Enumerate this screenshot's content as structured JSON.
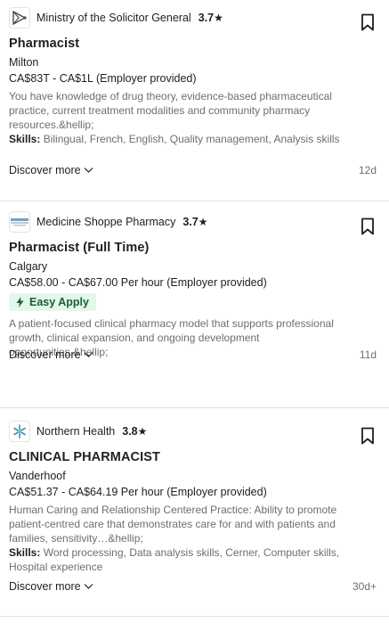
{
  "jobs": [
    {
      "company": "Ministry of the Solicitor General",
      "rating": "3.7",
      "title": "Pharmacist",
      "location": "Milton",
      "salary": "CA$83T - CA$1L (Employer provided)",
      "easy_apply": "",
      "snippet": "You have knowledge of drug theory, evidence-based pharmaceutical practice, current treatment modalities and community pharmacy resources.&hellip;",
      "skills_label": "Skills:",
      "skills": "Bilingual, French, English, Quality management, Analysis skills",
      "discover": "Discover more",
      "age": "12d"
    },
    {
      "company": "Medicine Shoppe Pharmacy",
      "rating": "3.7",
      "title": "Pharmacist (Full Time)",
      "location": "Calgary",
      "salary": "CA$58.00 - CA$67.00 Per hour (Employer provided)",
      "easy_apply": "Easy Apply",
      "snippet": "A patient-focused clinical pharmacy model that supports professional growth, clinical expansion, and ongoing development opportunities.&hellip;",
      "skills_label": "",
      "skills": "",
      "discover": "Discover more",
      "age": "11d"
    },
    {
      "company": "Northern Health",
      "rating": "3.8",
      "title": "CLINICAL PHARMACIST",
      "location": "Vanderhoof",
      "salary": "CA$51.37 - CA$64.19 Per hour (Employer provided)",
      "easy_apply": "",
      "snippet": "Human Caring and Relationship Centered Practice: Ability to promote patient-centred care that demonstrates care for and with patients and families, sensitivity…&hellip;",
      "skills_label": "Skills:",
      "skills": "Word processing, Data analysis skills, Cerner, Computer skills, Hospital experience",
      "discover": "Discover more",
      "age": "30d+"
    }
  ],
  "icons": {
    "bookmark": "bookmark-icon",
    "star": "star-icon",
    "chevron": "chevron-down-icon",
    "lightning": "lightning-icon"
  },
  "colors": {
    "easy_apply_bg": "#e3f7ea",
    "easy_apply_text": "#1b5e36",
    "muted_text": "#6e6e6e",
    "divider": "#e1e1e1"
  }
}
